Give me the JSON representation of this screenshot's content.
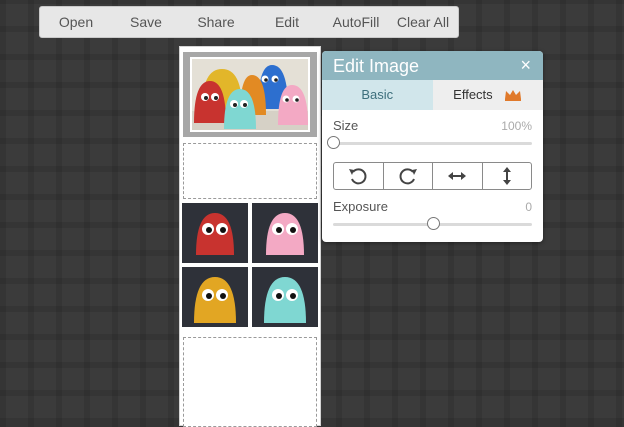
{
  "toolbar": {
    "items": [
      {
        "label": "Open"
      },
      {
        "label": "Save"
      },
      {
        "label": "Share"
      },
      {
        "label": "Edit"
      },
      {
        "label": "AutoFill"
      },
      {
        "label": "Clear All"
      }
    ]
  },
  "panel": {
    "title": "Edit Image",
    "close": "×",
    "tabs": {
      "basic": "Basic",
      "effects": "Effects",
      "effects_icon": "crown-icon"
    },
    "size": {
      "label": "Size",
      "value": "100%",
      "level": 0.0
    },
    "transform_icons": [
      "rotate-left-icon",
      "rotate-right-icon",
      "flip-horizontal-icon",
      "flip-vertical-icon"
    ],
    "exposure": {
      "label": "Exposure",
      "value": "0",
      "level": 0.5
    }
  },
  "colors": {
    "panel_header": "#8fb6c0",
    "basic_tab": "#d1e6eb",
    "crown": "#e0792b",
    "ghost_red": "#c8332f",
    "ghost_pink": "#f3a9c4",
    "ghost_yellow": "#e2a623",
    "ghost_cyan": "#7fd7d2",
    "ghost_blue": "#2d6fcf"
  }
}
